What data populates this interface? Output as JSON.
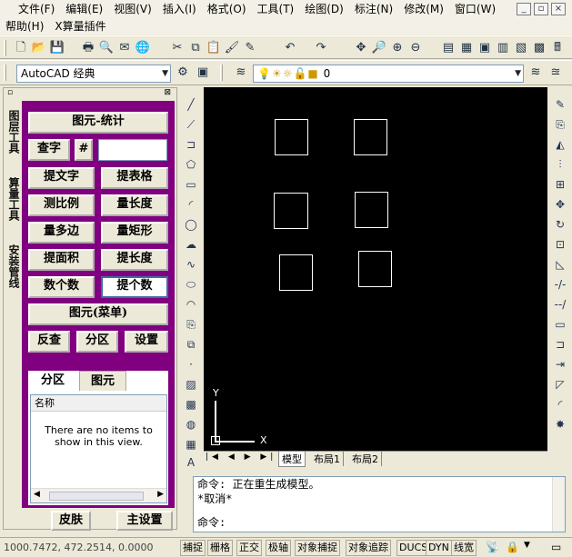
{
  "menu": {
    "row1": [
      "文件(F)",
      "编辑(E)",
      "视图(V)",
      "插入(I)",
      "格式(O)",
      "工具(T)",
      "绘图(D)",
      "标注(N)",
      "修改(M)",
      "窗口(W)"
    ],
    "row2": [
      "帮助(H)",
      "X算量插件"
    ]
  },
  "workspace": {
    "combo_value": "AutoCAD 经典"
  },
  "layer": {
    "combo_value": "0"
  },
  "panel": {
    "vertical_tabs": [
      "图层工具",
      "算量工具",
      "安装管线"
    ],
    "btn_stat": "图元-统计",
    "btn_find": "查字",
    "btn_hash": "#",
    "find_value": "",
    "grid": [
      [
        "提文字",
        "提表格"
      ],
      [
        "测比例",
        "量长度"
      ],
      [
        "量多边",
        "量矩形"
      ],
      [
        "提面积",
        "提长度"
      ],
      [
        "数个数",
        "提个数"
      ]
    ],
    "btn_menu": "图元(菜单)",
    "row3": [
      "反查",
      "分区",
      "设置"
    ],
    "tabs": [
      "分区",
      "图元"
    ],
    "list_header": "名称",
    "list_empty": "There are no items to show in this view.",
    "skin": "皮肤",
    "main_settings": "主设置"
  },
  "canvas": {
    "background": "#000000",
    "ucs_x": "X",
    "ucs_y": "Y"
  },
  "layout_tabs": [
    "模型",
    "布局1",
    "布局2"
  ],
  "command": {
    "lines": [
      "命令: 正在重生成模型。",
      "*取消*"
    ],
    "prompt": "命令:"
  },
  "status": {
    "coords": "1000.7472, 472.2514, 0.0000",
    "toggles": [
      "捕捉",
      "栅格",
      "正交",
      "极轴",
      "对象捕捉",
      "对象追踪",
      "DUCS",
      "DYN",
      "线宽"
    ]
  },
  "colors": {
    "panel_bg": "#800080",
    "canvas_bg": "#000000"
  }
}
